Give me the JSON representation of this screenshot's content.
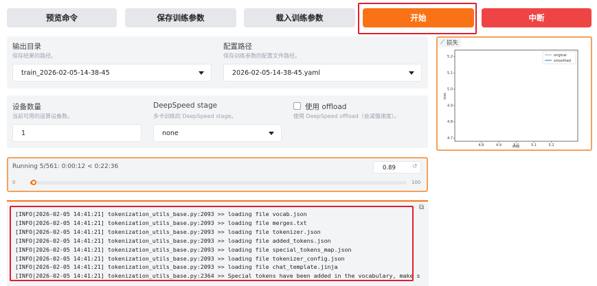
{
  "toolbar": {
    "preview_label": "预览命令",
    "save_label": "保存训练参数",
    "load_label": "载入训练参数",
    "start_label": "开始",
    "stop_label": "中断"
  },
  "output": {
    "label": "输出目录",
    "hint": "保存结果的路径。",
    "value": "train_2026-02-05-14-38-45"
  },
  "config": {
    "label": "配置路径",
    "hint": "保存训练参数的配置文件路径。",
    "value": "2026-02-05-14-38-45.yaml"
  },
  "devices": {
    "label": "设备数量",
    "hint": "当前可用的运算设备数。",
    "value": "1"
  },
  "deepspeed": {
    "label": "DeepSpeed stage",
    "hint": "多卡训练的 DeepSpeed stage。",
    "value": "none"
  },
  "offload": {
    "label": "使用 offload",
    "hint": "使用 DeepSpeed offload（会减慢速度）。"
  },
  "progress": {
    "status": "Running 5/561: 0:00:12 < 0:22:36",
    "value": "0.89",
    "min": "0",
    "max": "100",
    "fraction": 0.89
  },
  "loss_panel": {
    "tab_label": "损失",
    "icon": "chart-icon"
  },
  "chart_data": {
    "type": "line",
    "xlabel": "step",
    "ylabel": "loss",
    "xlim": [
      4.65,
      5.35
    ],
    "ylim": [
      4.68,
      5.24
    ],
    "x_ticks": [
      "4.8",
      "4.9",
      "5.0",
      "5.1",
      "5.2"
    ],
    "y_ticks": [
      "5.2",
      "5.1",
      "5.0",
      "4.9",
      "4.8",
      "4.7"
    ],
    "grid": false,
    "legend_position": "top-right",
    "series": [
      {
        "name": "original",
        "color": "#9ca3af",
        "x": [],
        "y": []
      },
      {
        "name": "smoothed",
        "color": "#1f77b4",
        "x": [],
        "y": []
      }
    ]
  },
  "logs": [
    "[INFO|2026-02-05 14:41:21] tokenization_utils_base.py:2093 >> loading file vocab.json",
    "[INFO|2026-02-05 14:41:21] tokenization_utils_base.py:2093 >> loading file merges.txt",
    "[INFO|2026-02-05 14:41:21] tokenization_utils_base.py:2093 >> loading file tokenizer.json",
    "[INFO|2026-02-05 14:41:21] tokenization_utils_base.py:2093 >> loading file added_tokens.json",
    "[INFO|2026-02-05 14:41:21] tokenization_utils_base.py:2093 >> loading file special_tokens_map.json",
    "[INFO|2026-02-05 14:41:21] tokenization_utils_base.py:2093 >> loading file tokenizer_config.json",
    "[INFO|2026-02-05 14:41:21] tokenization_utils_base.py:2093 >> loading file chat_template.jinja",
    "[INFO|2026-02-05 14:41:21] tokenization_utils_base.py:2364 >> Special tokens have been added in the vocabulary, make s"
  ],
  "colors": {
    "accent": "#f97316",
    "stop": "#ef4444",
    "highlight": "#e11d2e"
  }
}
